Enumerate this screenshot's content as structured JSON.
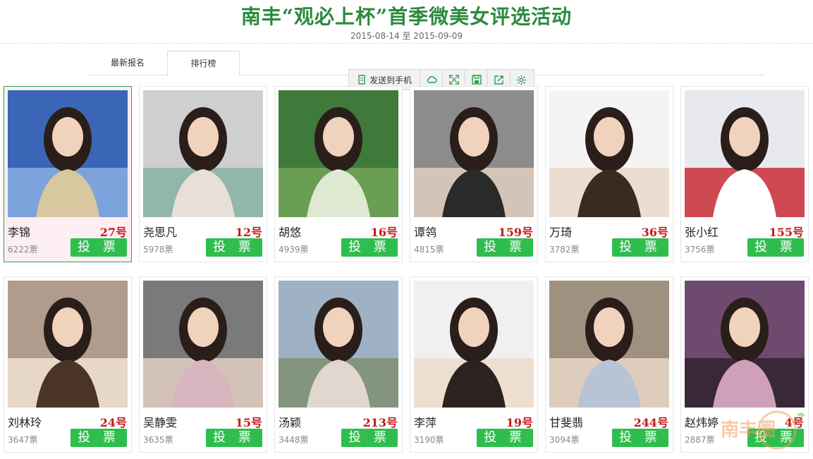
{
  "header": {
    "title": "南丰“观必上杯”首季微美女评选活动",
    "date_range": "2015-08-14 至 2015-09-09"
  },
  "tabs": [
    {
      "label": "最新报名"
    },
    {
      "label": "排行榜"
    }
  ],
  "toolbar": {
    "send_label": "发送到手机",
    "icons": [
      "cloud-icon",
      "fullscreen-icon",
      "save-icon",
      "share-icon",
      "settings-icon"
    ]
  },
  "vote_label": "投 票",
  "contestants": [
    {
      "name": "李锦",
      "number": "27号",
      "votes": "6222票"
    },
    {
      "name": "尧思凡",
      "number": "12号",
      "votes": "5978票"
    },
    {
      "name": "胡悠",
      "number": "16号",
      "votes": "4939票"
    },
    {
      "name": "谭鸰",
      "number": "159号",
      "votes": "4815票"
    },
    {
      "name": "万琦",
      "number": "36号",
      "votes": "3782票"
    },
    {
      "name": "张小红",
      "number": "155号",
      "votes": "3756票"
    },
    {
      "name": "刘林玲",
      "number": "24号",
      "votes": "3647票"
    },
    {
      "name": "吴静雯",
      "number": "15号",
      "votes": "3635票"
    },
    {
      "name": "汤颖",
      "number": "213号",
      "votes": "3448票"
    },
    {
      "name": "李萍",
      "number": "19号",
      "votes": "3190票"
    },
    {
      "name": "甘斐翡",
      "number": "244号",
      "votes": "3094票"
    },
    {
      "name": "赵炜婷",
      "number": "4号",
      "votes": "2887票"
    }
  ],
  "watermark": {
    "text": "南丰圈"
  },
  "colors": {
    "brand_green": "#2b8a3e",
    "vote_button": "#2fbe4e",
    "number_red": "#c41b1b"
  }
}
